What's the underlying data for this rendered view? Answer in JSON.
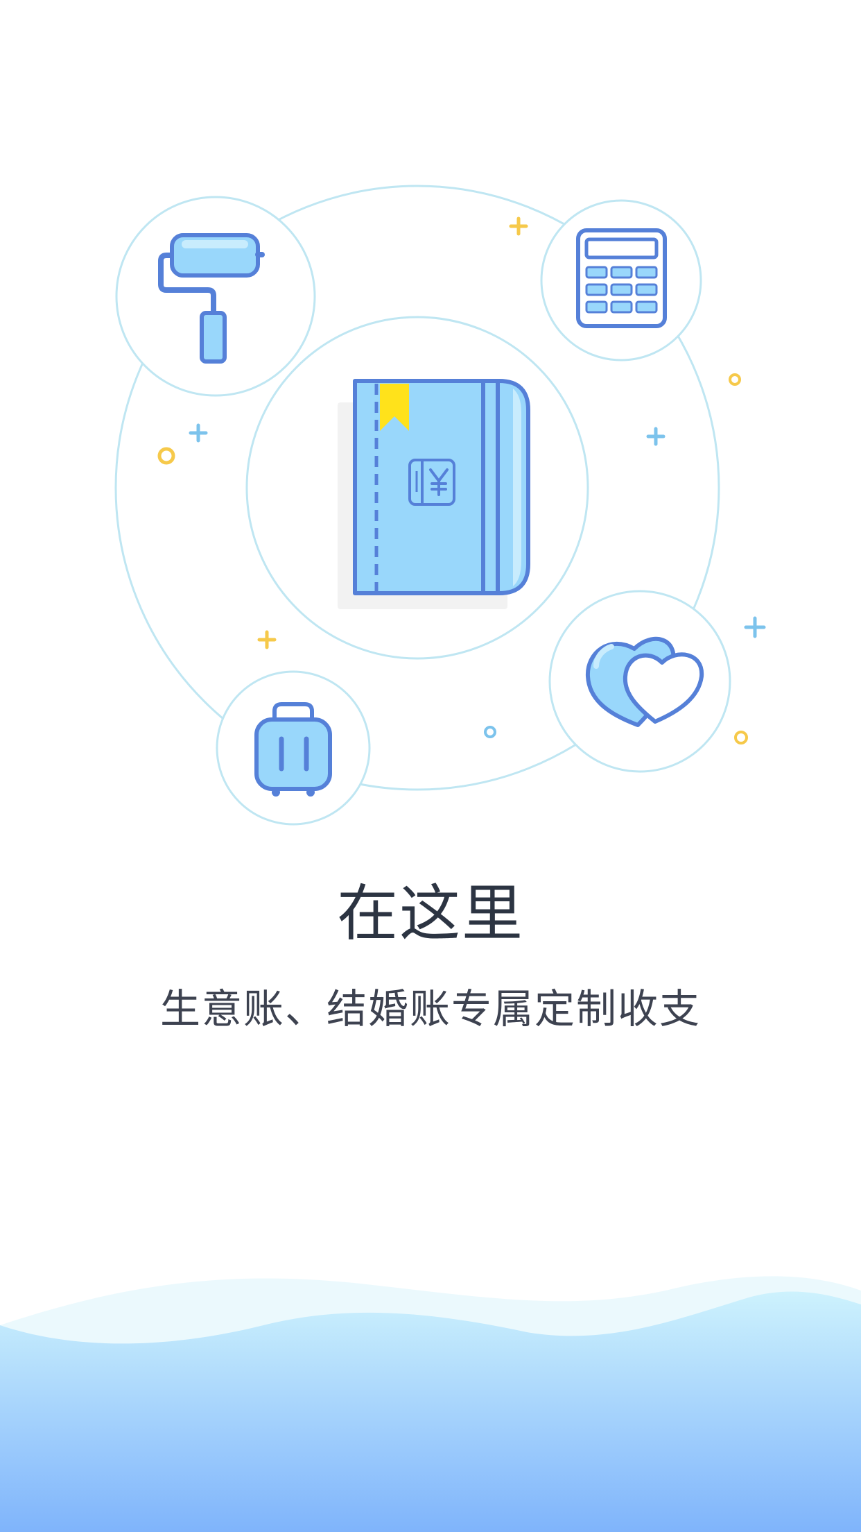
{
  "onboarding": {
    "title": "在这里",
    "subtitle": "生意账、结婚账专属定制收支"
  },
  "illustration": {
    "center_icon": "ledger-book-icon",
    "orbit_icons": [
      "paint-roller-icon",
      "calculator-icon",
      "hearts-icon",
      "luggage-icon"
    ],
    "colors": {
      "outline": "#5580d8",
      "fill": "#99d7fb",
      "orbit_ring": "#bfe6f2",
      "bookmark": "#ffe21b",
      "accent_yellow": "#f6c94a",
      "accent_blue": "#7cc3ec"
    }
  },
  "background": {
    "wave_top_color": "#cdf2fd",
    "wave_bottom_color": "#7fb4fb"
  }
}
